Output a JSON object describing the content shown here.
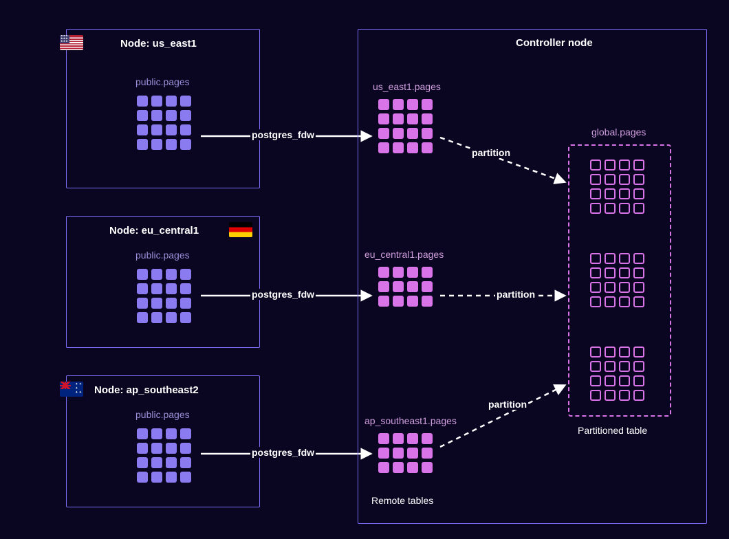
{
  "diagram": {
    "controller_title": "Controller node",
    "nodes": [
      {
        "id": "us_east1",
        "title": "Node: us_east1",
        "flag": "us",
        "table_label": "public.pages"
      },
      {
        "id": "eu_central1",
        "title": "Node: eu_central1",
        "flag": "de",
        "table_label": "public.pages"
      },
      {
        "id": "ap_southeast2",
        "title": "Node: ap_southeast2",
        "flag": "au",
        "table_label": "public.pages"
      }
    ],
    "remote_tables": [
      {
        "label": "us_east1.pages"
      },
      {
        "label": "eu_central1.pages"
      },
      {
        "label": "ap_southeast1.pages"
      }
    ],
    "global_table_label": "global.pages",
    "remote_tables_caption": "Remote tables",
    "partitioned_table_caption": "Partitioned table",
    "fdw_label": "postgres_fdw",
    "partition_label": "partition"
  }
}
